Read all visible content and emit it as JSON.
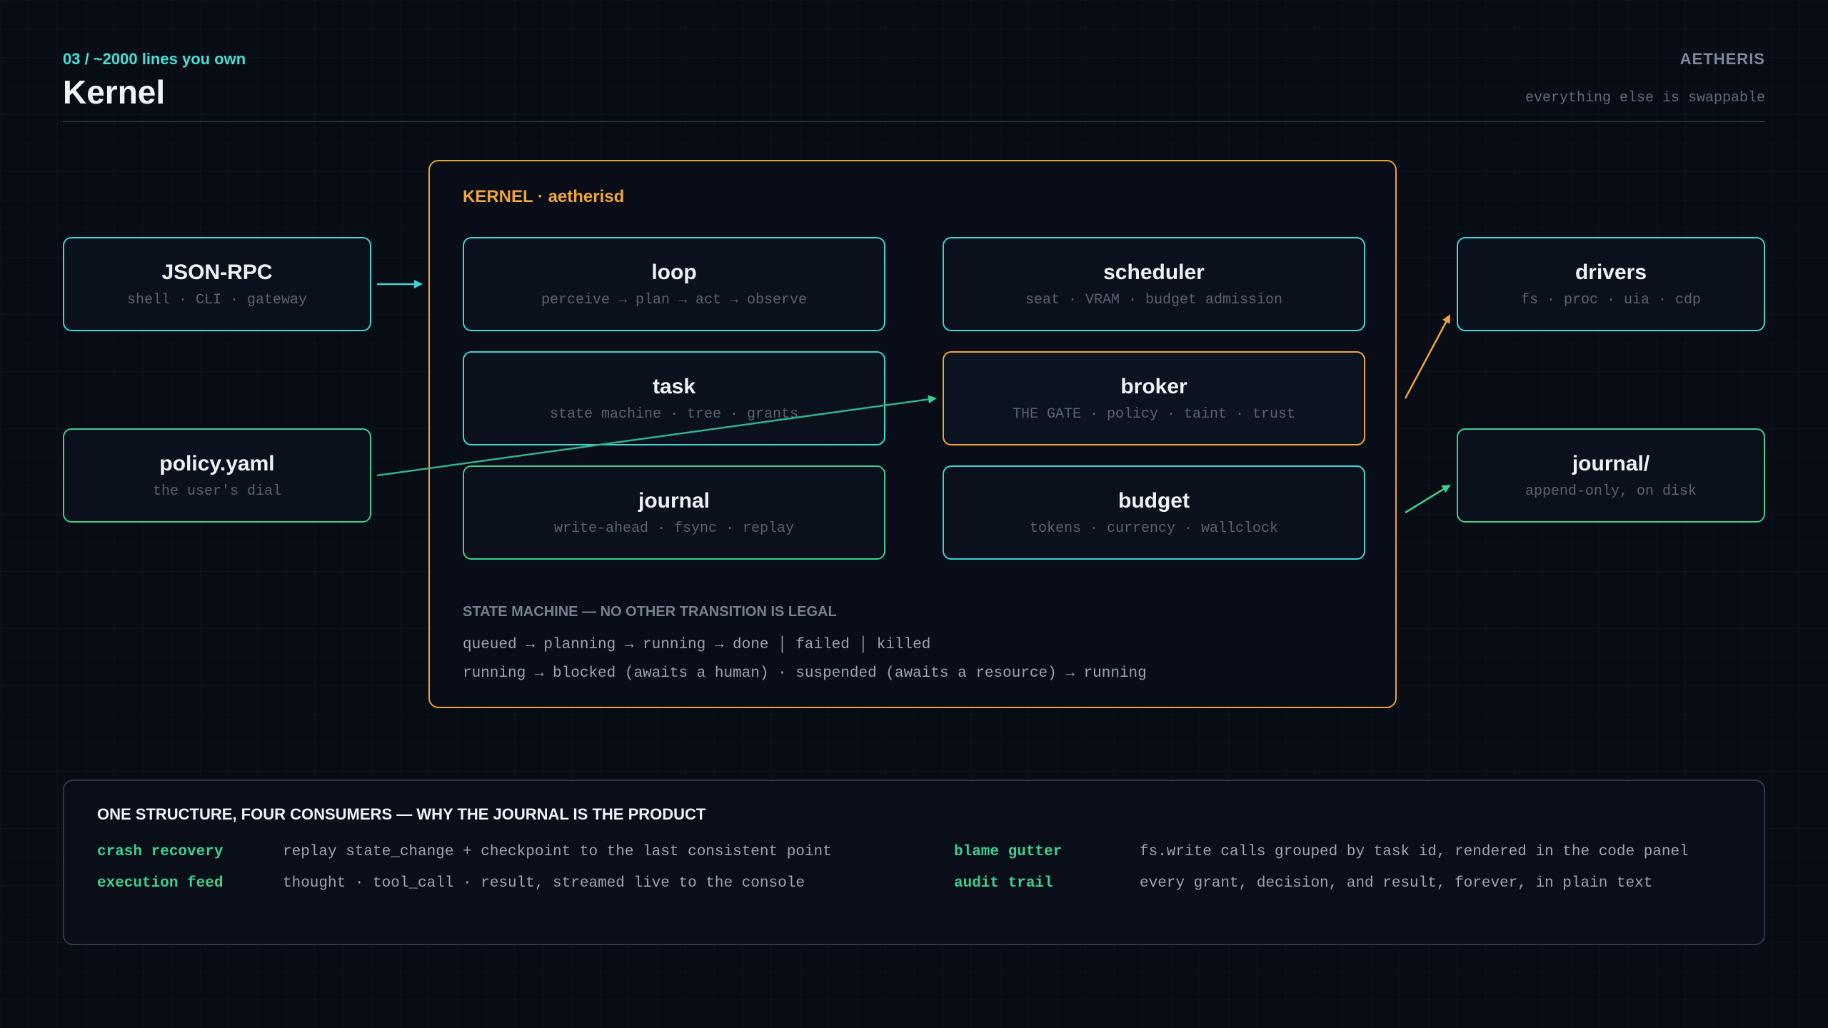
{
  "header": {
    "eyebrow": "03 / ~2000 lines you own",
    "title": "Kernel",
    "brand": "AETHERIS",
    "tagline": "everything else is swappable"
  },
  "colors": {
    "background": "#070c15",
    "teal": "#3ed6d0",
    "green": "#3ecf8e",
    "amber": "#f0a53c"
  },
  "inputs": {
    "jsonrpc": {
      "name": "JSON-RPC",
      "sub": "shell · CLI · gateway"
    },
    "policy": {
      "name": "policy.yaml",
      "sub": "the user's dial"
    }
  },
  "kernel": {
    "label": "KERNEL · aetherisd",
    "loop": {
      "name": "loop",
      "sub": "perceive → plan → act → observe"
    },
    "task": {
      "name": "task",
      "sub": "state machine · tree · grants"
    },
    "journal": {
      "name": "journal",
      "sub": "write-ahead · fsync · replay"
    },
    "scheduler": {
      "name": "scheduler",
      "sub": "seat · VRAM · budget admission"
    },
    "broker": {
      "name": "broker",
      "sub": "THE GATE · policy · taint · trust"
    },
    "budget": {
      "name": "budget",
      "sub": "tokens · currency · wallclock"
    },
    "state_machine": {
      "heading": "STATE MACHINE — NO OTHER TRANSITION IS LEGAL",
      "line1": "queued → planning → running → done │ failed │ killed",
      "line2": "running → blocked (awaits a human) · suspended (awaits a resource) → running"
    }
  },
  "outputs": {
    "drivers": {
      "name": "drivers",
      "sub": "fs · proc · uia · cdp"
    },
    "journal_dir": {
      "name": "journal/",
      "sub": "append-only, on disk"
    }
  },
  "consumers": {
    "heading": "ONE STRUCTURE, FOUR CONSUMERS — WHY THE JOURNAL IS THE PRODUCT",
    "items": [
      {
        "key": "crash recovery",
        "value": "replay state_change + checkpoint to the last consistent point"
      },
      {
        "key": "execution feed",
        "value": "thought · tool_call · result, streamed live to the console"
      },
      {
        "key": "blame gutter",
        "value": "fs.write calls grouped by task id, rendered in the code panel"
      },
      {
        "key": "audit trail",
        "value": "every grant, decision, and result, forever, in plain text"
      }
    ]
  }
}
